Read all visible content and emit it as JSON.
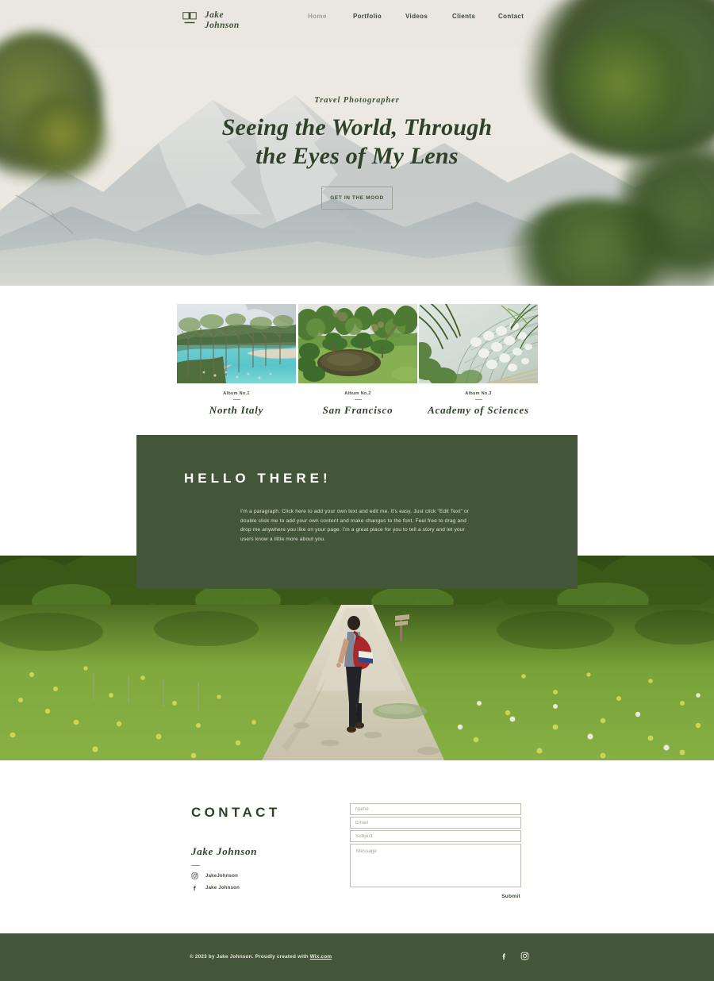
{
  "header": {
    "logo_icon": "open-book-icon",
    "brand_line1": "Jake",
    "brand_line2": "Johnson",
    "nav": [
      {
        "label": "Home",
        "active": true
      },
      {
        "label": "Portfolio",
        "active": false
      },
      {
        "label": "Videos",
        "active": false
      },
      {
        "label": "Clients",
        "active": false
      },
      {
        "label": "Contact",
        "active": false
      }
    ]
  },
  "hero": {
    "kicker": "Travel Photographer",
    "title_line1": "Seeing the World, Through",
    "title_line2": "the Eyes of My Lens",
    "cta_label": "GET IN THE MOOD",
    "background_description": "misty mountain with blurred green foliage"
  },
  "albums": [
    {
      "caption": "Album No.1",
      "title": "North Italy",
      "photo": "turquoise-lake-with-trees"
    },
    {
      "caption": "Album No.2",
      "title": "San Francisco",
      "photo": "japanese-garden-pond"
    },
    {
      "caption": "Album No.3",
      "title": "Academy of Sciences",
      "photo": "greenhouse-dome-palms"
    }
  ],
  "intro": {
    "heading": "HELLO THERE!",
    "paragraph": "I'm a paragraph. Click here to add your own text and edit me. It's easy. Just click \"Edit Text\" or double click me to add your own content and make changes to the font. Feel free to drag and drop me anywhere you like on your page. I'm a great place for you to tell a story and let your users know a little more about you."
  },
  "feature_photo": {
    "description": "hiker with red backpack walking on dirt path through green meadow"
  },
  "contact": {
    "title": "CONTACT",
    "name": "Jake Johnson",
    "socials": [
      {
        "icon": "instagram-icon",
        "handle": "JakeJohnson"
      },
      {
        "icon": "facebook-icon",
        "handle": "Jake Johnson"
      }
    ],
    "form": {
      "name_placeholder": "Name",
      "email_placeholder": "Email",
      "subject_placeholder": "Subject",
      "message_placeholder": "Message",
      "submit_label": "Submit",
      "name_value": "",
      "email_value": "",
      "subject_value": "",
      "message_value": ""
    }
  },
  "footer": {
    "copyright_before": "© 2023 by Jake Johnson. Proudly created with ",
    "link_label": "Wix.com",
    "socials": [
      "facebook-icon",
      "instagram-icon"
    ]
  },
  "colors": {
    "green": "#44563a",
    "dark_green_text": "#2f4229",
    "muted_nav": "#9aa191",
    "hero_bg": "#eceae3",
    "border_gray": "#b9c0b2"
  }
}
